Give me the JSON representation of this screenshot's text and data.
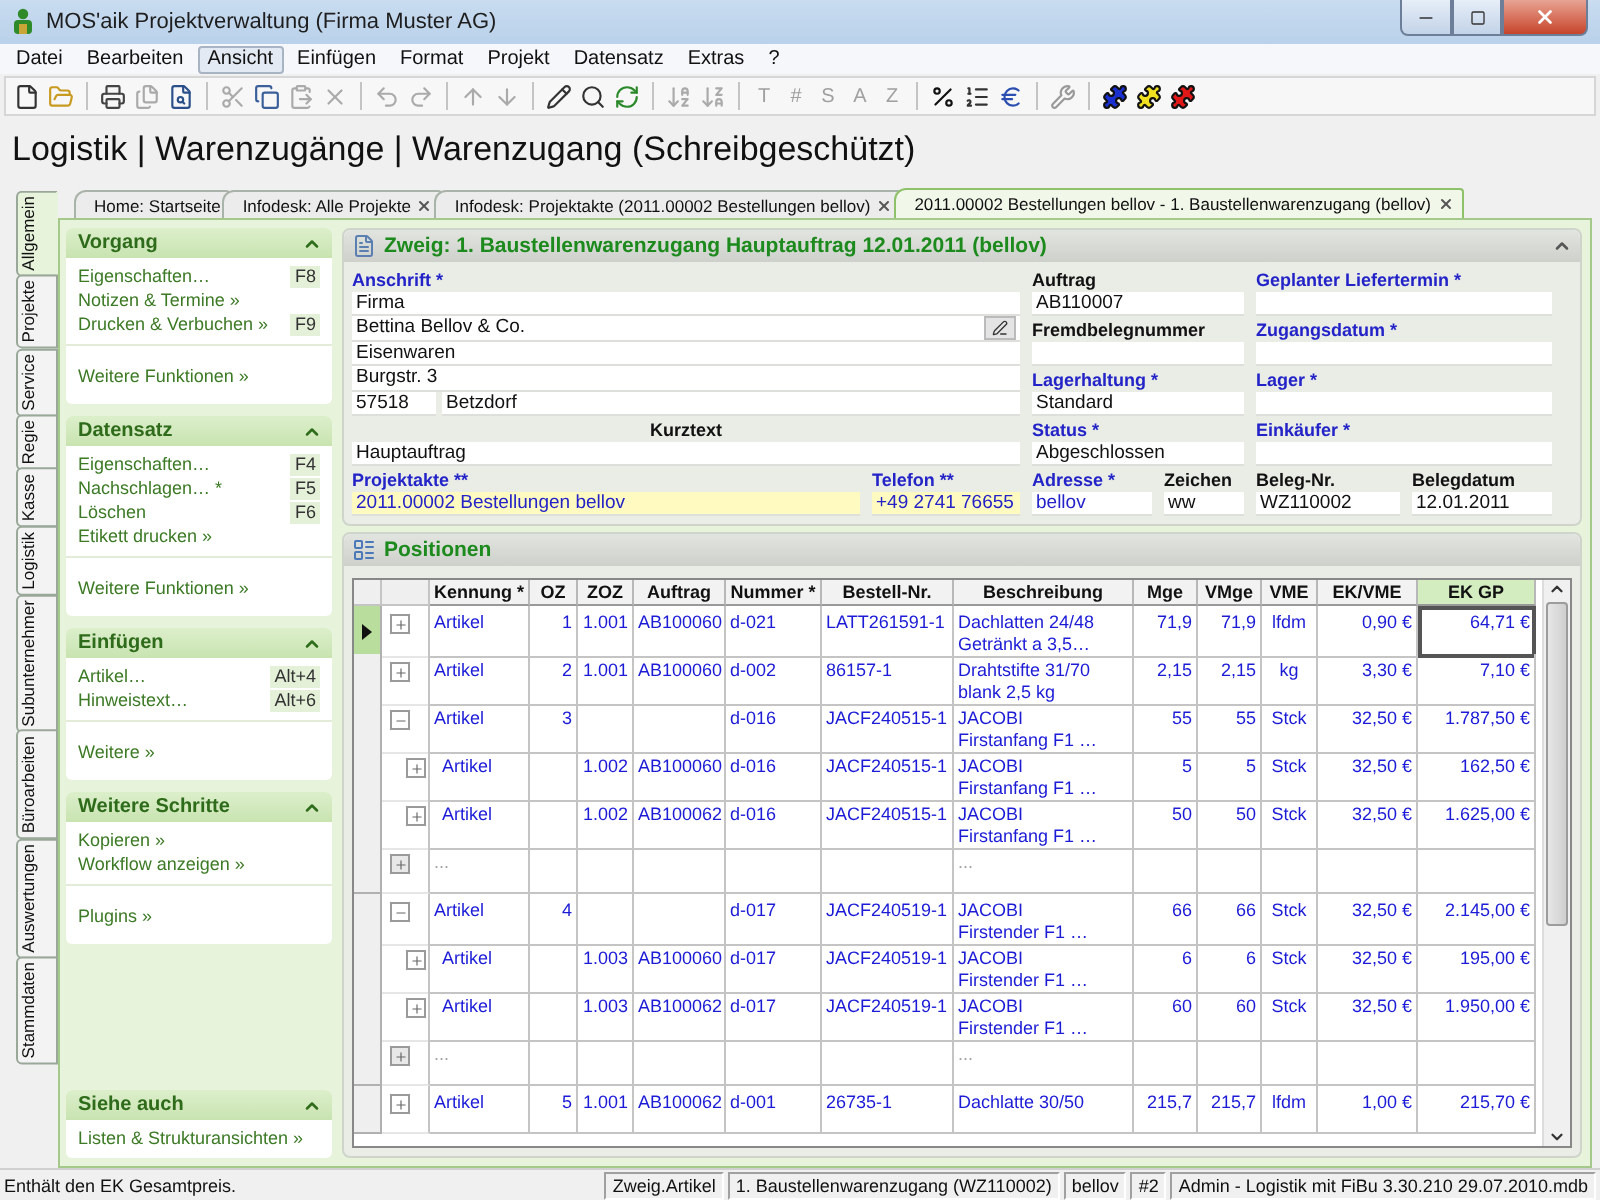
{
  "window": {
    "title": "MOS'aik Projektverwaltung (Firma Muster AG)"
  },
  "menu": [
    {
      "label": "Datei",
      "selected": false
    },
    {
      "label": "Bearbeiten",
      "selected": false
    },
    {
      "label": "Ansicht",
      "selected": true
    },
    {
      "label": "Einfügen",
      "selected": false
    },
    {
      "label": "Format",
      "selected": false
    },
    {
      "label": "Projekt",
      "selected": false
    },
    {
      "label": "Datensatz",
      "selected": false
    },
    {
      "label": "Extras",
      "selected": false
    },
    {
      "label": "?",
      "selected": false
    }
  ],
  "toolbar": {
    "letter_buttons": [
      {
        "label": "T",
        "disabled": true
      },
      {
        "label": "#",
        "disabled": true
      },
      {
        "label": "S",
        "disabled": true
      },
      {
        "label": "A",
        "disabled": true
      },
      {
        "label": "Z",
        "disabled": true
      }
    ]
  },
  "page_title": "Logistik | Warenzugänge | Warenzugang (Schreibgeschützt)",
  "side_tabs": [
    {
      "label": "Allgemein",
      "selected": true
    },
    {
      "label": "Projekte",
      "selected": false
    },
    {
      "label": "Service",
      "selected": false
    },
    {
      "label": "Regie",
      "selected": false
    },
    {
      "label": "Kasse",
      "selected": false
    },
    {
      "label": "Logistik",
      "selected": false
    },
    {
      "label": "Subunternehmer",
      "selected": false
    },
    {
      "label": "Büroarbeiten",
      "selected": false
    },
    {
      "label": "Auswertungen",
      "selected": false
    },
    {
      "label": "Stammdaten",
      "selected": false
    }
  ],
  "tabs": [
    {
      "label": "Home: Startseite",
      "closable": false,
      "selected": false
    },
    {
      "label": "Infodesk: Alle Projekte",
      "closable": true,
      "selected": false
    },
    {
      "label": "Infodesk: Projektakte (2011.00002 Bestellungen bellov)",
      "closable": true,
      "selected": false
    },
    {
      "label": "2011.00002 Bestellungen bellov - 1. Baustellenwarenzugang (bellov)",
      "closable": true,
      "selected": true
    }
  ],
  "task_panel": {
    "sections": [
      {
        "title": "Vorgang",
        "expanded": true,
        "items": [
          {
            "label": "Eigenschaften…",
            "shortcut": "F8"
          },
          {
            "label": "Notizen & Termine »"
          },
          {
            "label": "Drucken & Verbuchen »",
            "shortcut": "F9"
          }
        ],
        "more": [
          "Weitere Funktionen »"
        ]
      },
      {
        "title": "Datensatz",
        "expanded": true,
        "items": [
          {
            "label": "Eigenschaften…",
            "shortcut": "F4"
          },
          {
            "label": "Nachschlagen… *",
            "shortcut": "F5"
          },
          {
            "label": "Löschen",
            "shortcut": "F6"
          },
          {
            "label": "Etikett drucken »"
          }
        ],
        "more": [
          "Weitere Funktionen »"
        ]
      },
      {
        "title": "Einfügen",
        "expanded": true,
        "items": [
          {
            "label": "Artikel…",
            "shortcut": "Alt+4"
          },
          {
            "label": "Hinweistext…",
            "shortcut": "Alt+6"
          }
        ],
        "more": [
          "Weitere »"
        ]
      },
      {
        "title": "Weitere Schritte",
        "expanded": true,
        "items": [
          {
            "label": "Kopieren »"
          },
          {
            "label": "Workflow anzeigen »"
          }
        ],
        "more": [
          "Plugins »"
        ]
      },
      {
        "title": "Siehe auch",
        "expanded": true,
        "items": [
          {
            "label": "Listen & Strukturansichten »"
          }
        ]
      }
    ]
  },
  "form": {
    "title": "Zweig: 1. Baustellenwarenzugang Hauptauftrag 12.01.2011 (bellov)",
    "expanded": true,
    "address": {
      "label": "Anschrift *",
      "required": true,
      "lines": [
        {
          "value": "Firma",
          "has_button": false
        },
        {
          "value": "Bettina Bellov & Co.",
          "has_button": true
        },
        {
          "value": "Eisenwaren",
          "has_button": false
        },
        {
          "value": "Burgstr. 3",
          "has_button": false
        }
      ],
      "zip": "57518",
      "city": "Betzdorf"
    },
    "short_text": {
      "label": "Kurztext",
      "value": "Hauptauftrag"
    },
    "fields": [
      {
        "label": "Auftrag",
        "value": "AB110007",
        "required": false,
        "highlighted": false,
        "link": false
      },
      {
        "label": "Geplanter Liefertermin *",
        "required": true,
        "highlighted": false
      },
      {
        "label": "Fremdbelegnummer",
        "required": false,
        "highlighted": false
      },
      {
        "label": "Zugangsdatum *",
        "required": true,
        "highlighted": false
      },
      {
        "label": "Lagerhaltung *",
        "value": "Standard",
        "required": true,
        "highlighted": false,
        "link": false
      },
      {
        "label": "Lager *",
        "required": true,
        "highlighted": false
      },
      {
        "label": "Status *",
        "value": "Abgeschlossen",
        "required": true,
        "highlighted": false,
        "link": false
      },
      {
        "label": "Einkäufer *",
        "required": true,
        "highlighted": false
      },
      {
        "label": "Projektakte **",
        "value": "2011.00002 Bestellungen bellov",
        "required": true,
        "highlighted": true,
        "link": true
      },
      {
        "label": "Telefon **",
        "value": "+49 2741 76655",
        "required": true,
        "highlighted": true,
        "link": true
      },
      {
        "label": "Adresse *",
        "value": "bellov",
        "required": true,
        "highlighted": false,
        "link": true
      },
      {
        "label": "Zeichen",
        "value": "ww",
        "required": false,
        "highlighted": false,
        "link": false
      },
      {
        "label": "Beleg-Nr.",
        "value": "WZ110002",
        "required": false,
        "highlighted": false,
        "link": false
      },
      {
        "label": "Belegdatum",
        "value": "12.01.2011",
        "required": false,
        "highlighted": false,
        "link": false
      }
    ]
  },
  "positions": {
    "title": "Positionen",
    "columns": [
      {
        "label": "Kennung *",
        "selected": false
      },
      {
        "label": "OZ",
        "selected": false
      },
      {
        "label": "ZOZ",
        "selected": false
      },
      {
        "label": "Auftrag",
        "selected": false
      },
      {
        "label": "Nummer *",
        "selected": false
      },
      {
        "label": "Bestell-Nr.",
        "selected": false
      },
      {
        "label": "Beschreibung",
        "selected": false
      },
      {
        "label": "Mge",
        "selected": false
      },
      {
        "label": "VMge",
        "selected": false
      },
      {
        "label": "VME",
        "selected": false
      },
      {
        "label": "EK/VME",
        "selected": false
      },
      {
        "label": "EK GP",
        "selected": true
      }
    ],
    "rows": [
      {
        "kind": "item",
        "expanded": false,
        "selected": true,
        "cells": [
          "Artikel",
          "1",
          "1.001",
          "AB100060",
          "d-021",
          "LATT261591-1",
          [
            "Dachlatten 24/48",
            "Getränkt a 3,5…"
          ],
          "71,9",
          "71,9",
          "lfdm",
          "0,90 €",
          "64,71 €"
        ]
      },
      {
        "kind": "item",
        "expanded": false,
        "selected": false,
        "cells": [
          "Artikel",
          "2",
          "1.001",
          "AB100060",
          "d-002",
          "86157-1",
          [
            "Drahtstifte 31/70",
            "blank 2,5 kg"
          ],
          "2,15",
          "2,15",
          "kg",
          "3,30 €",
          "7,10 €"
        ]
      },
      {
        "kind": "item",
        "expanded": true,
        "selected": false,
        "cells": [
          "Artikel",
          "3",
          null,
          null,
          "d-016",
          "JACF240515-1",
          [
            "JACOBI",
            "Firstanfang F1 …"
          ],
          "55",
          "55",
          "Stck",
          "32,50 €",
          "1.787,50 €"
        ]
      },
      {
        "kind": "sub",
        "expanded": false,
        "selected": false,
        "cells": [
          "Artikel",
          null,
          "1.002",
          "AB100060",
          "d-016",
          "JACF240515-1",
          [
            "JACOBI",
            "Firstanfang F1 …"
          ],
          "5",
          "5",
          "Stck",
          "32,50 €",
          "162,50 €"
        ]
      },
      {
        "kind": "sub",
        "expanded": false,
        "selected": false,
        "cells": [
          "Artikel",
          null,
          "1.002",
          "AB100062",
          "d-016",
          "JACF240515-1",
          [
            "JACOBI",
            "Firstanfang F1 …"
          ],
          "50",
          "50",
          "Stck",
          "32,50 €",
          "1.625,00 €"
        ]
      },
      {
        "kind": "ellipsis",
        "expanded": false,
        "selected": false,
        "cells": [
          "...",
          null,
          null,
          null,
          null,
          null,
          [
            "..."
          ],
          null,
          null,
          null,
          null,
          null
        ]
      },
      {
        "kind": "item",
        "expanded": true,
        "selected": false,
        "cells": [
          "Artikel",
          "4",
          null,
          null,
          "d-017",
          "JACF240519-1",
          [
            "JACOBI",
            "Firstender  F1 …"
          ],
          "66",
          "66",
          "Stck",
          "32,50 €",
          "2.145,00 €"
        ]
      },
      {
        "kind": "sub",
        "expanded": false,
        "selected": false,
        "cells": [
          "Artikel",
          null,
          "1.003",
          "AB100060",
          "d-017",
          "JACF240519-1",
          [
            "JACOBI",
            "Firstender  F1 …"
          ],
          "6",
          "6",
          "Stck",
          "32,50 €",
          "195,00 €"
        ]
      },
      {
        "kind": "sub",
        "expanded": false,
        "selected": false,
        "cells": [
          "Artikel",
          null,
          "1.003",
          "AB100062",
          "d-017",
          "JACF240519-1",
          [
            "JACOBI",
            "Firstender  F1 …"
          ],
          "60",
          "60",
          "Stck",
          "32,50 €",
          "1.950,00 €"
        ]
      },
      {
        "kind": "ellipsis",
        "expanded": false,
        "selected": false,
        "cells": [
          "...",
          null,
          null,
          null,
          null,
          null,
          [
            "..."
          ],
          null,
          null,
          null,
          null,
          null
        ]
      },
      {
        "kind": "item",
        "expanded": false,
        "selected": false,
        "cells": [
          "Artikel",
          "5",
          "1.001",
          "AB100062",
          "d-001",
          "26735-1",
          [
            "Dachlatte 30/50"
          ],
          "215,7",
          "215,7",
          "lfdm",
          "1,00 €",
          "215,70 €"
        ]
      }
    ]
  },
  "status_bar": {
    "message": "Enthält den EK Gesamtpreis.",
    "cells": [
      "Zweig.Artikel",
      "1. Baustellenwarenzugang (WZ110002)",
      "bellov",
      "#2",
      "Admin - Logistik mit FiBu 3.30.210 29.07.2010.mdb"
    ]
  }
}
